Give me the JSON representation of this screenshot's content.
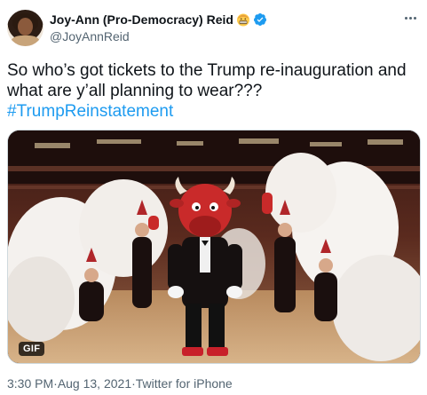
{
  "author": {
    "display_name": "Joy-Ann (Pro-Democracy) Reid",
    "handle": "@JoyAnnReid",
    "emoji_icon": "grimacing-face-with-helmet-icon",
    "verified_icon": "verified-badge-icon"
  },
  "tweet": {
    "line1": "So who’s got tickets to the Trump re-inauguration and",
    "line2": "what are y’all planning to wear???",
    "hashtag": "#TrumpReinstatement"
  },
  "media": {
    "badge": "GIF",
    "content_icon": "mascot-with-feather-fan-dancers-image"
  },
  "meta": {
    "time": "3:30 PM",
    "separator1": " · ",
    "date": "Aug 13, 2021",
    "separator2": " · ",
    "source": "Twitter for iPhone"
  },
  "colors": {
    "link": "#1d9bf0",
    "secondary_text": "#536471",
    "verified": "#1d9bf0"
  }
}
